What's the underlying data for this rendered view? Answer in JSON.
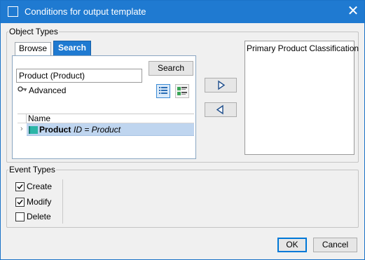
{
  "window": {
    "title": "Conditions for output template",
    "close_glyph": "✕",
    "icon": "window-icon",
    "accent": "#1f7ad1"
  },
  "object_types": {
    "group_label": "Object Types",
    "tabs": [
      {
        "label": "Browse",
        "active": false
      },
      {
        "label": "Search",
        "active": true
      }
    ],
    "search_value": "Product (Product)",
    "search_button": "Search",
    "advanced_label": "Advanced",
    "advanced_icon": "key-icon",
    "view_icons": [
      "list-view-icon",
      "detail-view-icon"
    ],
    "results": {
      "column_header": "Name",
      "rows": [
        {
          "name": "Product",
          "id_text": "ID = Product",
          "icon": "product-icon",
          "selected": true
        }
      ]
    },
    "add_icon": "arrow-right-icon",
    "remove_icon": "arrow-left-icon",
    "selected_items": [
      "Primary Product Classification"
    ]
  },
  "event_types": {
    "group_label": "Event Types",
    "items": [
      {
        "label": "Create",
        "checked": true
      },
      {
        "label": "Modify",
        "checked": true
      },
      {
        "label": "Delete",
        "checked": false
      }
    ]
  },
  "footer": {
    "ok_label": "OK",
    "cancel_label": "Cancel"
  }
}
